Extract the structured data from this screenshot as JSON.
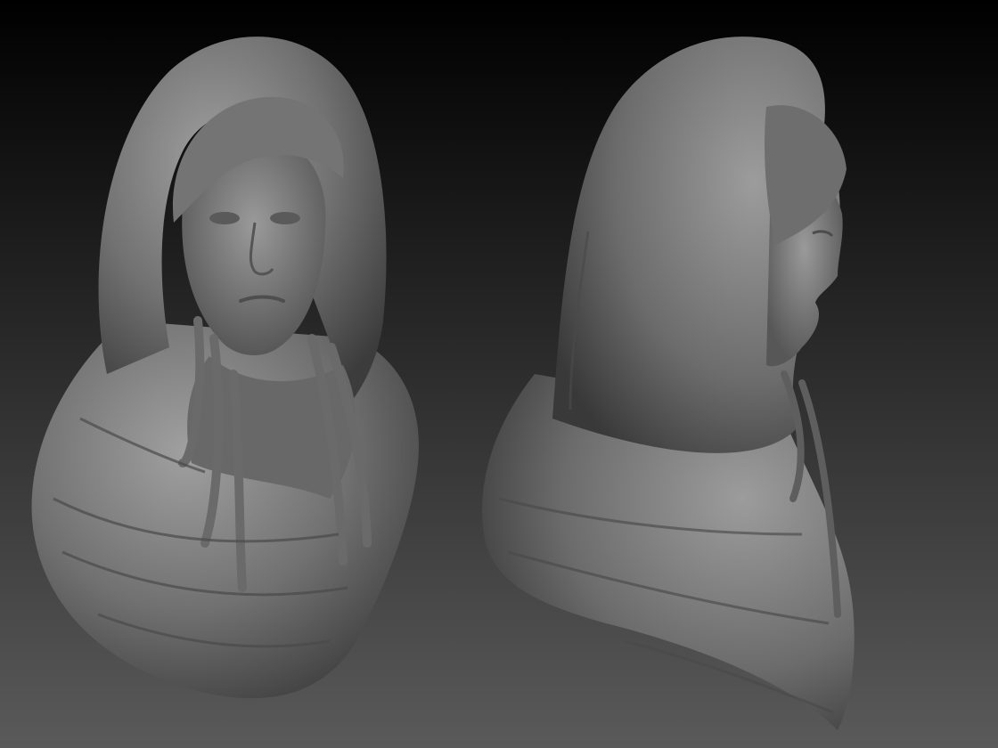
{
  "scene": {
    "background_top": "#000000",
    "background_bottom": "#5a5a5a",
    "material_light": "#9a9a9a",
    "material_mid": "#6e6e6e",
    "material_dark": "#3a3a3a",
    "subjects": [
      "front-view-bust",
      "side-view-bust"
    ]
  }
}
